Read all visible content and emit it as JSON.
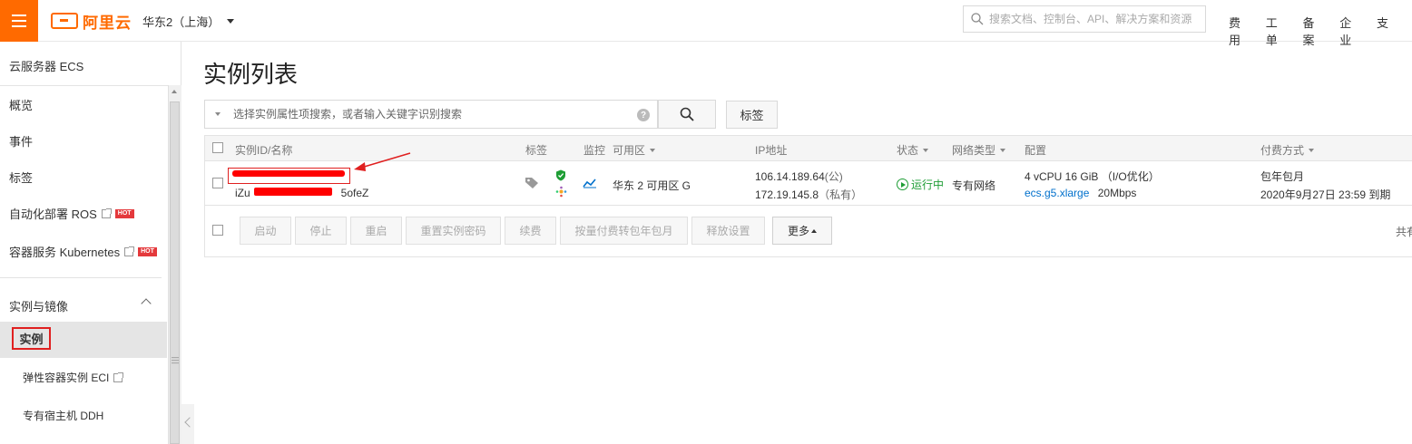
{
  "topbar": {
    "logo_text": "阿里云",
    "region": "华东2（上海）",
    "search_placeholder": "搜索文档、控制台、API、解决方案和资源",
    "links": [
      "费用",
      "工单",
      "备案",
      "企业",
      "支"
    ]
  },
  "sidebar": {
    "title": "云服务器 ECS",
    "items": [
      {
        "label": "概览"
      },
      {
        "label": "事件"
      },
      {
        "label": "标签"
      },
      {
        "label": "自动化部署 ROS",
        "hot": "HOT"
      },
      {
        "label": "容器服务 Kubernetes",
        "hot": "HOT"
      }
    ],
    "group": "实例与镜像",
    "active": "实例",
    "sub_items": [
      "弹性容器实例 ECI",
      "专有宿主机 DDH"
    ]
  },
  "main": {
    "title": "实例列表",
    "filter_placeholder": "选择实例属性项搜索，或者输入关键字识别搜索",
    "help_glyph": "?",
    "tag_button": "标签",
    "columns": {
      "id": "实例ID/名称",
      "tags": "标签",
      "monitor": "监控",
      "zone": "可用区",
      "ip": "IP地址",
      "status": "状态",
      "network": "网络类型",
      "config": "配置",
      "billing": "付费方式"
    },
    "row": {
      "id_prefix": "iZu",
      "id_suffix": "5ofeZ",
      "zone": "华东 2 可用区 G",
      "ip_public": "106.14.189.64",
      "ip_public_tag": "(公)",
      "ip_private": "172.19.145.8",
      "ip_private_tag": "（私有）",
      "status": "运行中",
      "network": "专有网络",
      "config_line1": "4 vCPU 16 GiB （I/O优化）",
      "instance_type": "ecs.g5.xlarge",
      "bandwidth": "20Mbps",
      "billing_type": "包年包月",
      "expiry": "2020年9月27日 23:59 到期"
    },
    "actions": [
      "启动",
      "停止",
      "重启",
      "重置实例密码",
      "续费",
      "按量付费转包年包月",
      "释放设置"
    ],
    "more_label": "更多",
    "total_label": "共有"
  },
  "colors": {
    "brand": "#ff6a00",
    "highlight": "#e02020",
    "link": "#0070cc",
    "running": "#1e9d35"
  }
}
